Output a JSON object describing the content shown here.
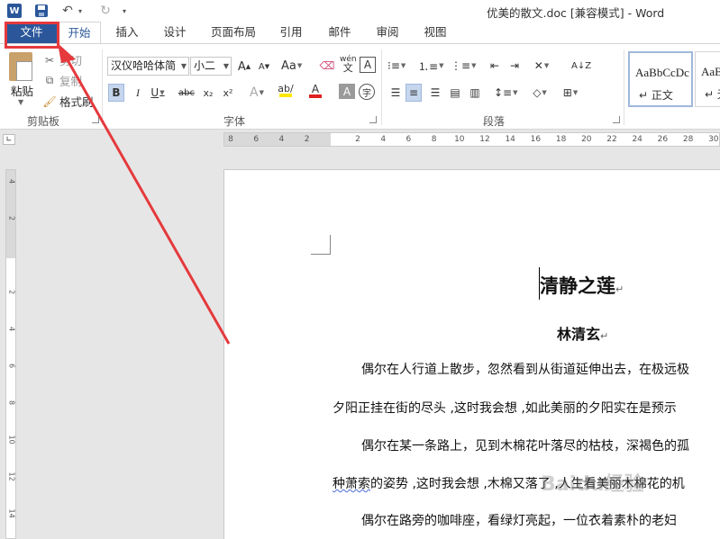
{
  "app": {
    "doc_title": "优美的散文.doc [兼容模式] - Word",
    "logo_letter": "W"
  },
  "tabs": [
    {
      "label": "文件"
    },
    {
      "label": "开始"
    },
    {
      "label": "插入"
    },
    {
      "label": "设计"
    },
    {
      "label": "页面布局"
    },
    {
      "label": "引用"
    },
    {
      "label": "邮件"
    },
    {
      "label": "审阅"
    },
    {
      "label": "视图"
    }
  ],
  "clipboard": {
    "paste_label": "粘贴",
    "cut_label": "剪切",
    "copy_label": "复制",
    "format_painter_label": "格式刷",
    "group_label": "剪贴板"
  },
  "font": {
    "family": "汉仪哈哈体简",
    "size": "小二",
    "group_label": "字体",
    "pinyin_glyph": "wén",
    "char_border_glyph": "A",
    "case_glyph": "Aa",
    "bold": "B",
    "italic": "I",
    "underline": "U",
    "strike": "abc",
    "sub": "x₂",
    "sup": "x²",
    "text_effect": "A",
    "font_color": "A",
    "char_shading": "A",
    "enclose": "字"
  },
  "paragraph": {
    "group_label": "段落"
  },
  "styles": [
    {
      "preview": "AaBbCcDc",
      "name": "↵ 正文"
    },
    {
      "preview": "AaBl",
      "name": "↵ 无"
    }
  ],
  "ruler": {
    "h_ticks": [
      "8",
      "6",
      "4",
      "2",
      "",
      "2",
      "4",
      "6",
      "8",
      "10",
      "12",
      "14",
      "16",
      "18",
      "20",
      "22",
      "24",
      "26",
      "28",
      "30"
    ],
    "v_ticks": [
      "4",
      "2",
      "",
      "2",
      "4",
      "6",
      "8",
      "10",
      "12",
      "14"
    ]
  },
  "document": {
    "title": "清静之莲",
    "author": "林清玄",
    "lines": [
      "偶尔在人行道上散步，忽然看到从街道延伸出去，在极远极",
      "夕阳正挂在街的尽头 ,这时我会想 ,如此美丽的夕阳实在是预示",
      "偶尔在某一条路上，见到木棉花叶落尽的枯枝，深褐色的孤",
      "种萧索的姿势 ,这时我会想 ,木棉又落了 ,人生看美丽木棉花的机",
      "偶尔在路旁的咖啡座，看绿灯亮起，一位衣着素朴的老妇"
    ],
    "squiggle_word": "种萧索"
  },
  "watermark": "Baidu经验",
  "colors": {
    "file_tab_bg": "#2b579a",
    "highlight_red": "#e5393c",
    "accent_blue": "#2b579a"
  }
}
